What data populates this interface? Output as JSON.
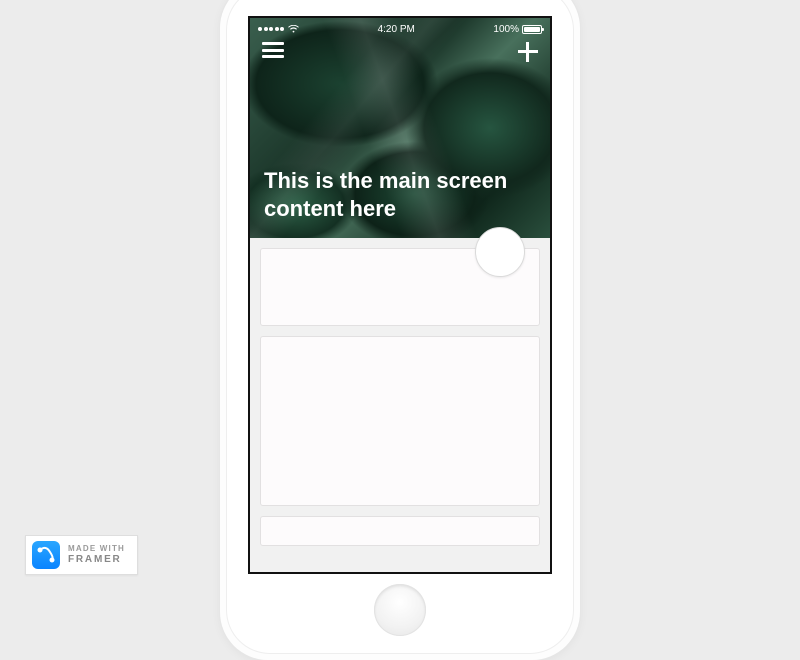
{
  "status": {
    "time": "4:20 PM",
    "battery_pct": "100%"
  },
  "header": {
    "title": "This is the main screen content here"
  },
  "badge": {
    "line1": "MADE WITH",
    "line2": "FRAMER"
  }
}
